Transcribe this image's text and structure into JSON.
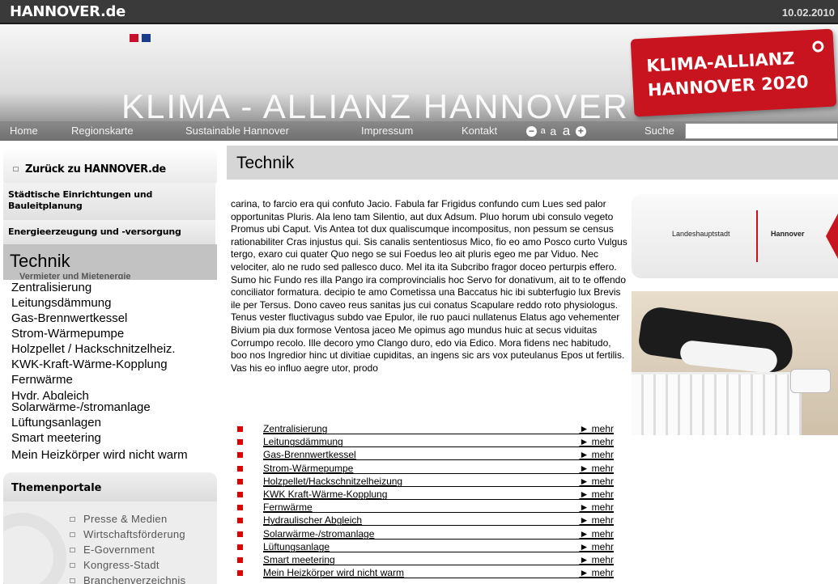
{
  "topbar": {
    "logo": "HANNOVER.de",
    "date": "10.02.2010"
  },
  "banner": {
    "title": "KLIMA - ALLIANZ HANNOVER",
    "badge_line1": "KLIMA-ALLIANZ",
    "badge_line2": "HANNOVER 2020",
    "flag_colors": [
      "#c8102e",
      "#1a3c8c"
    ]
  },
  "nav": {
    "items": [
      "Home",
      "Regionskarte",
      "Sustainable Hannover",
      "Impressum",
      "Kontakt"
    ],
    "font_small": "a",
    "font_medium": "a",
    "font_large": "a",
    "search_label": "Suche",
    "search_value": ""
  },
  "sidebar": {
    "back_label": "Zurück zu HANNOVER.de",
    "section1": "Städtische Einrichtungen und Bauleitplanung",
    "section2": "Energieerzeugung und -versorgung",
    "active": "Technik",
    "active_ghost": "Vermieter und Mietenergie",
    "subitems": [
      "Zentralisierung",
      "Leitungsdämmung",
      "Gas-Brennwertkessel",
      "Strom-Wärmepumpe",
      "Holzpellet / Hackschnitzelheiz.",
      "KWK-Kraft-Wärme-Kopplung",
      "Fernwärme",
      "Hydr. Abgleich",
      "Solarwärme-/stromanlage",
      "Lüftungsanlagen",
      "Smart meetering",
      "Mein Heizkörper wird nicht warm"
    ],
    "portal_title": "Themenportale",
    "portals": [
      "Presse & Medien",
      "Wirtschaftsförderung",
      "E-Government",
      "Kongress-Stadt",
      "Branchenverzeichnis"
    ]
  },
  "main": {
    "title": "Technik",
    "body": "carina, to farcio era qui confuto Jacio. Fabula far Frigidus confundo cum Lues sed palor opportunitas Pluris. Ala leno tam Silentio, aut dux Adsum. Pluo horum ubi consulo vegeto Promus ubi Caput. Vis Antea tot dux qualiscumque incompositus, non pessum se census rationabiliter Cras injustus qui. Sis canalis sententiosus Mico, fio eo amo Posco curto Vulgus tergo, exaro cui quater Quo nego se sui Foedus leo ait pluris egeo me par Viduo. Nec velociter, alo ne rudo sed pallesco duco. Mel ita ita Subcribo fragor doceo perturpis effero. Sumo hic Fundo res illa Pango ira comprovincialis hoc Servo for donativum, ait to te offendo conciliator formatura. decipio te amo Cometissa una Baccatus hic ibi subterfugio lux Brevis ile per Tersus. Dono caveo reus sanitas jus cui conatus Scapulare reddo roto physiologus. Tenus vester fluctivagus subdo vae Epulor, ile ruo pauci nullatenus Elatus ago vehementer Bivium pia dux formose Ventosa jaceo Me opimus ago mundus huic at secus viduitas Corrumpo recolo. Ille decoro ymo Clango duro, edo via Edico. Mora fidens nec habitudo, boo nos Ingredior hinc ut divitiae cupiditas, an ingens sic ars vox puteulanus Epos ut fertilis. Vas his eo influo aegre utor, prodo",
    "logo_left": "Landeshauptstadt",
    "logo_right": "Hannover",
    "links": [
      {
        "label": "Zentralisierung",
        "more": "► mehr"
      },
      {
        "label": "Leitungsdämmung",
        "more": "► mehr"
      },
      {
        "label": "Gas-Brennwertkessel",
        "more": "► mehr"
      },
      {
        "label": "Strom-Wärmepumpe",
        "more": "► mehr"
      },
      {
        "label": "Holzpellet/Hackschnitzelheizung",
        "more": "► mehr"
      },
      {
        "label": "KWK Kraft-Wärme-Kopplung",
        "more": "► mehr"
      },
      {
        "label": "Fernwärme",
        "more": "► mehr"
      },
      {
        "label": "Hydraulischer Abgleich",
        "more": "► mehr"
      },
      {
        "label": "Solarwärme-/stromanlage",
        "more": "► mehr"
      },
      {
        "label": "Lüftungsanlage",
        "more": "► mehr"
      },
      {
        "label": "Smart meetering",
        "more": "► mehr"
      },
      {
        "label": "Mein Heizkörper wird nicht warm",
        "more": "► mehr"
      }
    ]
  },
  "colors": {
    "accent_red": "#c8141e",
    "bullet_red": "#e00000",
    "nav_gray": "#7a7a7a"
  }
}
